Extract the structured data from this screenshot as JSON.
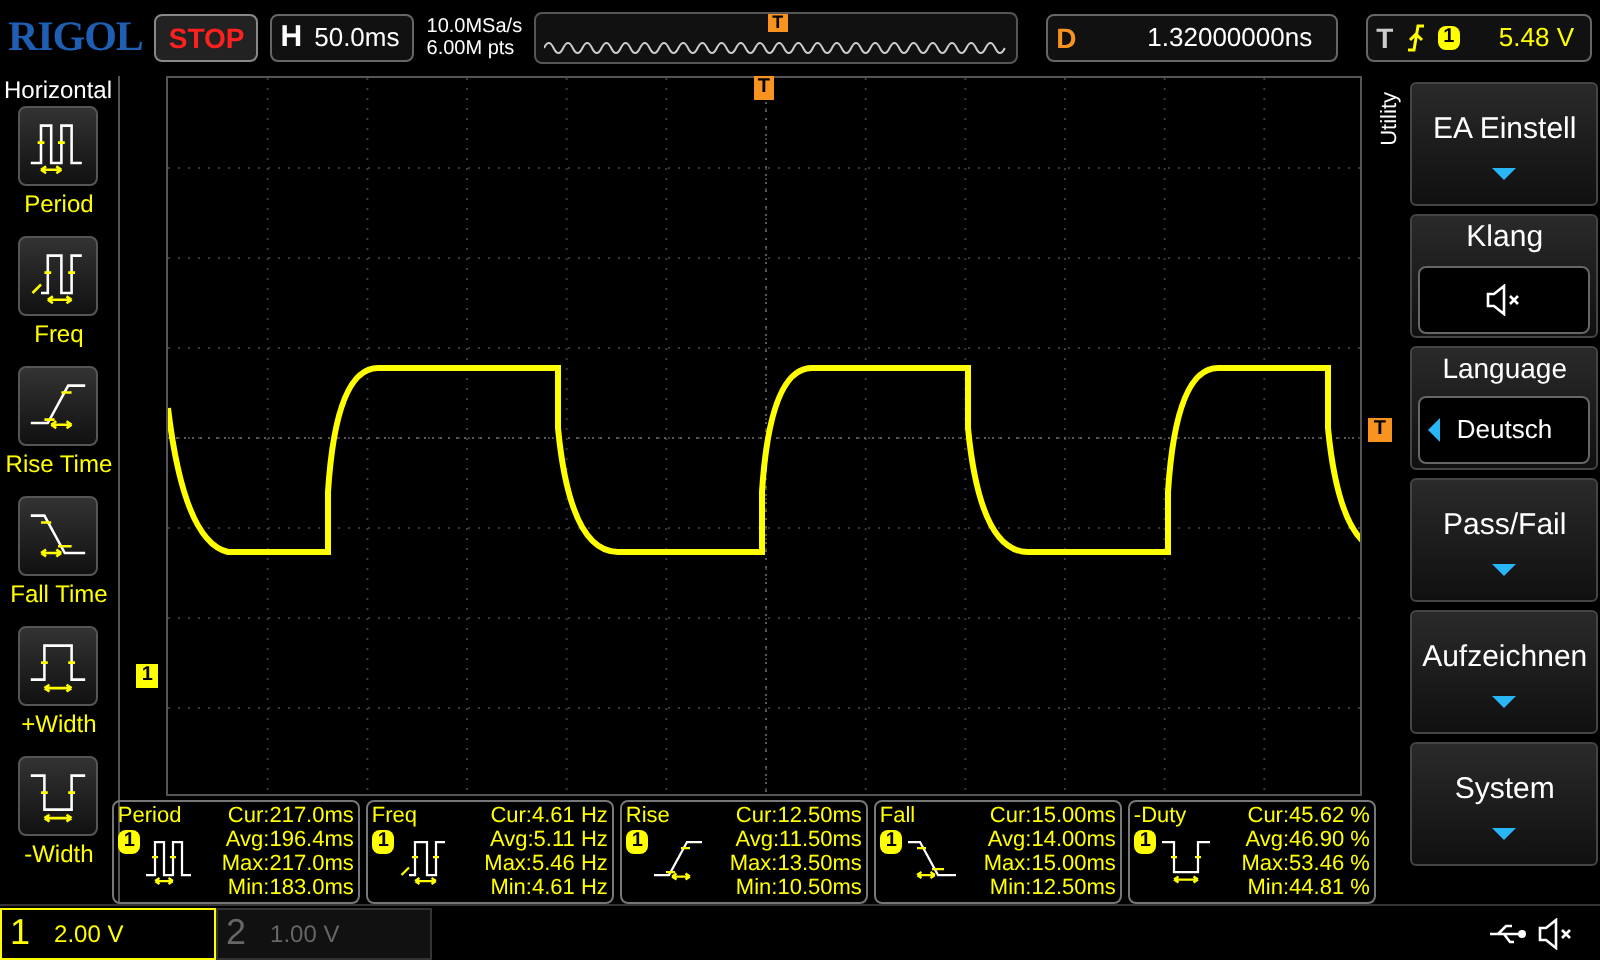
{
  "top_bar": {
    "logo": "RIGOL",
    "run_state": "STOP",
    "timebase": {
      "label": "H",
      "value": "50.0ms"
    },
    "sample_rate": "10.0MSa/s",
    "memory_depth": "6.00M pts",
    "trigger_position_marker": "T",
    "delay": {
      "label": "D",
      "value": "1.32000000ns"
    },
    "trigger": {
      "label": "T",
      "source": "1",
      "level": "5.48 V"
    }
  },
  "left_menu": {
    "title": "Horizontal",
    "items": [
      {
        "kind": "period",
        "label": "Period"
      },
      {
        "kind": "freq",
        "label": "Freq"
      },
      {
        "kind": "rise",
        "label": "Rise Time"
      },
      {
        "kind": "fall",
        "label": "Fall Time"
      },
      {
        "kind": "pwidth",
        "label": "+Width"
      },
      {
        "kind": "nwidth",
        "label": "-Width"
      }
    ]
  },
  "graticule": {
    "trigger_marker": "T",
    "trigger_level_marker": "T",
    "channel_marker": "1"
  },
  "right_menu": {
    "tab": "Utility",
    "buttons": [
      {
        "kind": "dropdown",
        "label": "EA Einstell"
      },
      {
        "kind": "toggle",
        "label": "Klang",
        "muted": true
      },
      {
        "kind": "select",
        "label": "Language",
        "value": "Deutsch"
      },
      {
        "kind": "dropdown",
        "label": "Pass/Fail"
      },
      {
        "kind": "dropdown",
        "label": "Aufzeichnen"
      },
      {
        "kind": "dropdown",
        "label": "System"
      }
    ]
  },
  "measurements": [
    {
      "kind": "period",
      "name": "Period",
      "source": "1",
      "cur": "Cur:217.0ms",
      "avg": "Avg:196.4ms",
      "max": "Max:217.0ms",
      "min": "Min:183.0ms"
    },
    {
      "kind": "freq",
      "name": "Freq",
      "source": "1",
      "cur": "Cur:4.61 Hz",
      "avg": "Avg:5.11 Hz",
      "max": "Max:5.46 Hz",
      "min": "Min:4.61 Hz"
    },
    {
      "kind": "rise",
      "name": "Rise",
      "source": "1",
      "cur": "Cur:12.50ms",
      "avg": "Avg:11.50ms",
      "max": "Max:13.50ms",
      "min": "Min:10.50ms"
    },
    {
      "kind": "fall",
      "name": "Fall",
      "source": "1",
      "cur": "Cur:15.00ms",
      "avg": "Avg:14.00ms",
      "max": "Max:15.00ms",
      "min": "Min:12.50ms"
    },
    {
      "kind": "nduty",
      "name": "-Duty",
      "source": "1",
      "cur": "Cur:45.62 %",
      "avg": "Avg:46.90 %",
      "max": "Max:53.46 %",
      "min": "Min:44.81 %"
    }
  ],
  "channels": [
    {
      "number": "1",
      "scale": "2.00 V",
      "on": true
    },
    {
      "number": "2",
      "scale": "1.00 V",
      "on": false
    }
  ]
}
